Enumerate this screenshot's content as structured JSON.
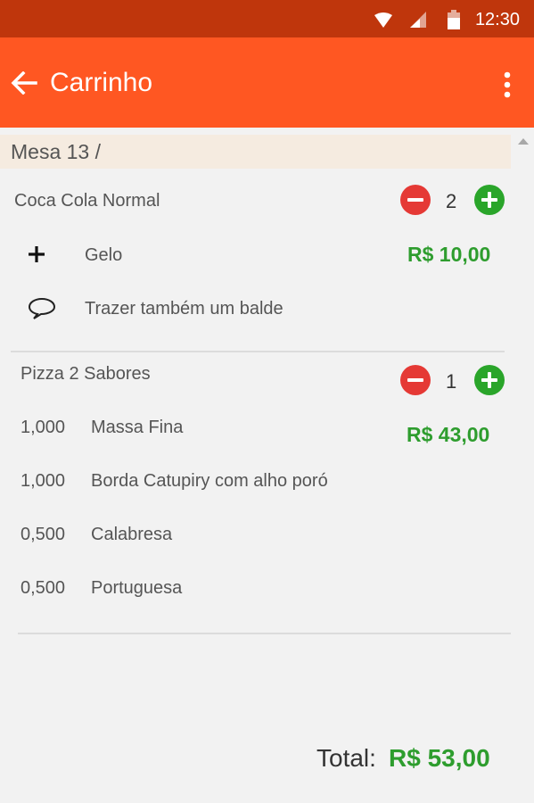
{
  "status": {
    "time": "12:30",
    "icons": [
      "wifi-icon",
      "signal-icon",
      "battery-icon"
    ]
  },
  "appbar": {
    "title": "Carrinho",
    "back_icon": "arrow-left-icon",
    "menu_icon": "more-vert-icon",
    "color": "#ff5722"
  },
  "table": {
    "label": "Mesa 13 /"
  },
  "items": [
    {
      "name": "Coca Cola Normal",
      "quantity": "2",
      "price": "R$ 10,00",
      "extras": [
        {
          "icon": "plus-icon",
          "label": "Gelo"
        }
      ],
      "note": {
        "icon": "speech-bubble-icon",
        "text": "Trazer também um balde"
      }
    },
    {
      "name": "Pizza 2 Sabores",
      "quantity": "1",
      "price": "R$ 43,00",
      "components": [
        {
          "qty": "1,000",
          "label": "Massa Fina"
        },
        {
          "qty": "1,000",
          "label": "Borda Catupiry com alho poró"
        },
        {
          "qty": "0,500",
          "label": "Calabresa"
        },
        {
          "qty": "0,500",
          "label": "Portuguesa"
        }
      ]
    }
  ],
  "total": {
    "label": "Total:",
    "value": "R$ 53,00"
  },
  "colors": {
    "accent": "#ff5722",
    "status_bar": "#bf360c",
    "price": "#2e9d2e",
    "minus": "#e53935",
    "plus": "#2aa52a"
  }
}
